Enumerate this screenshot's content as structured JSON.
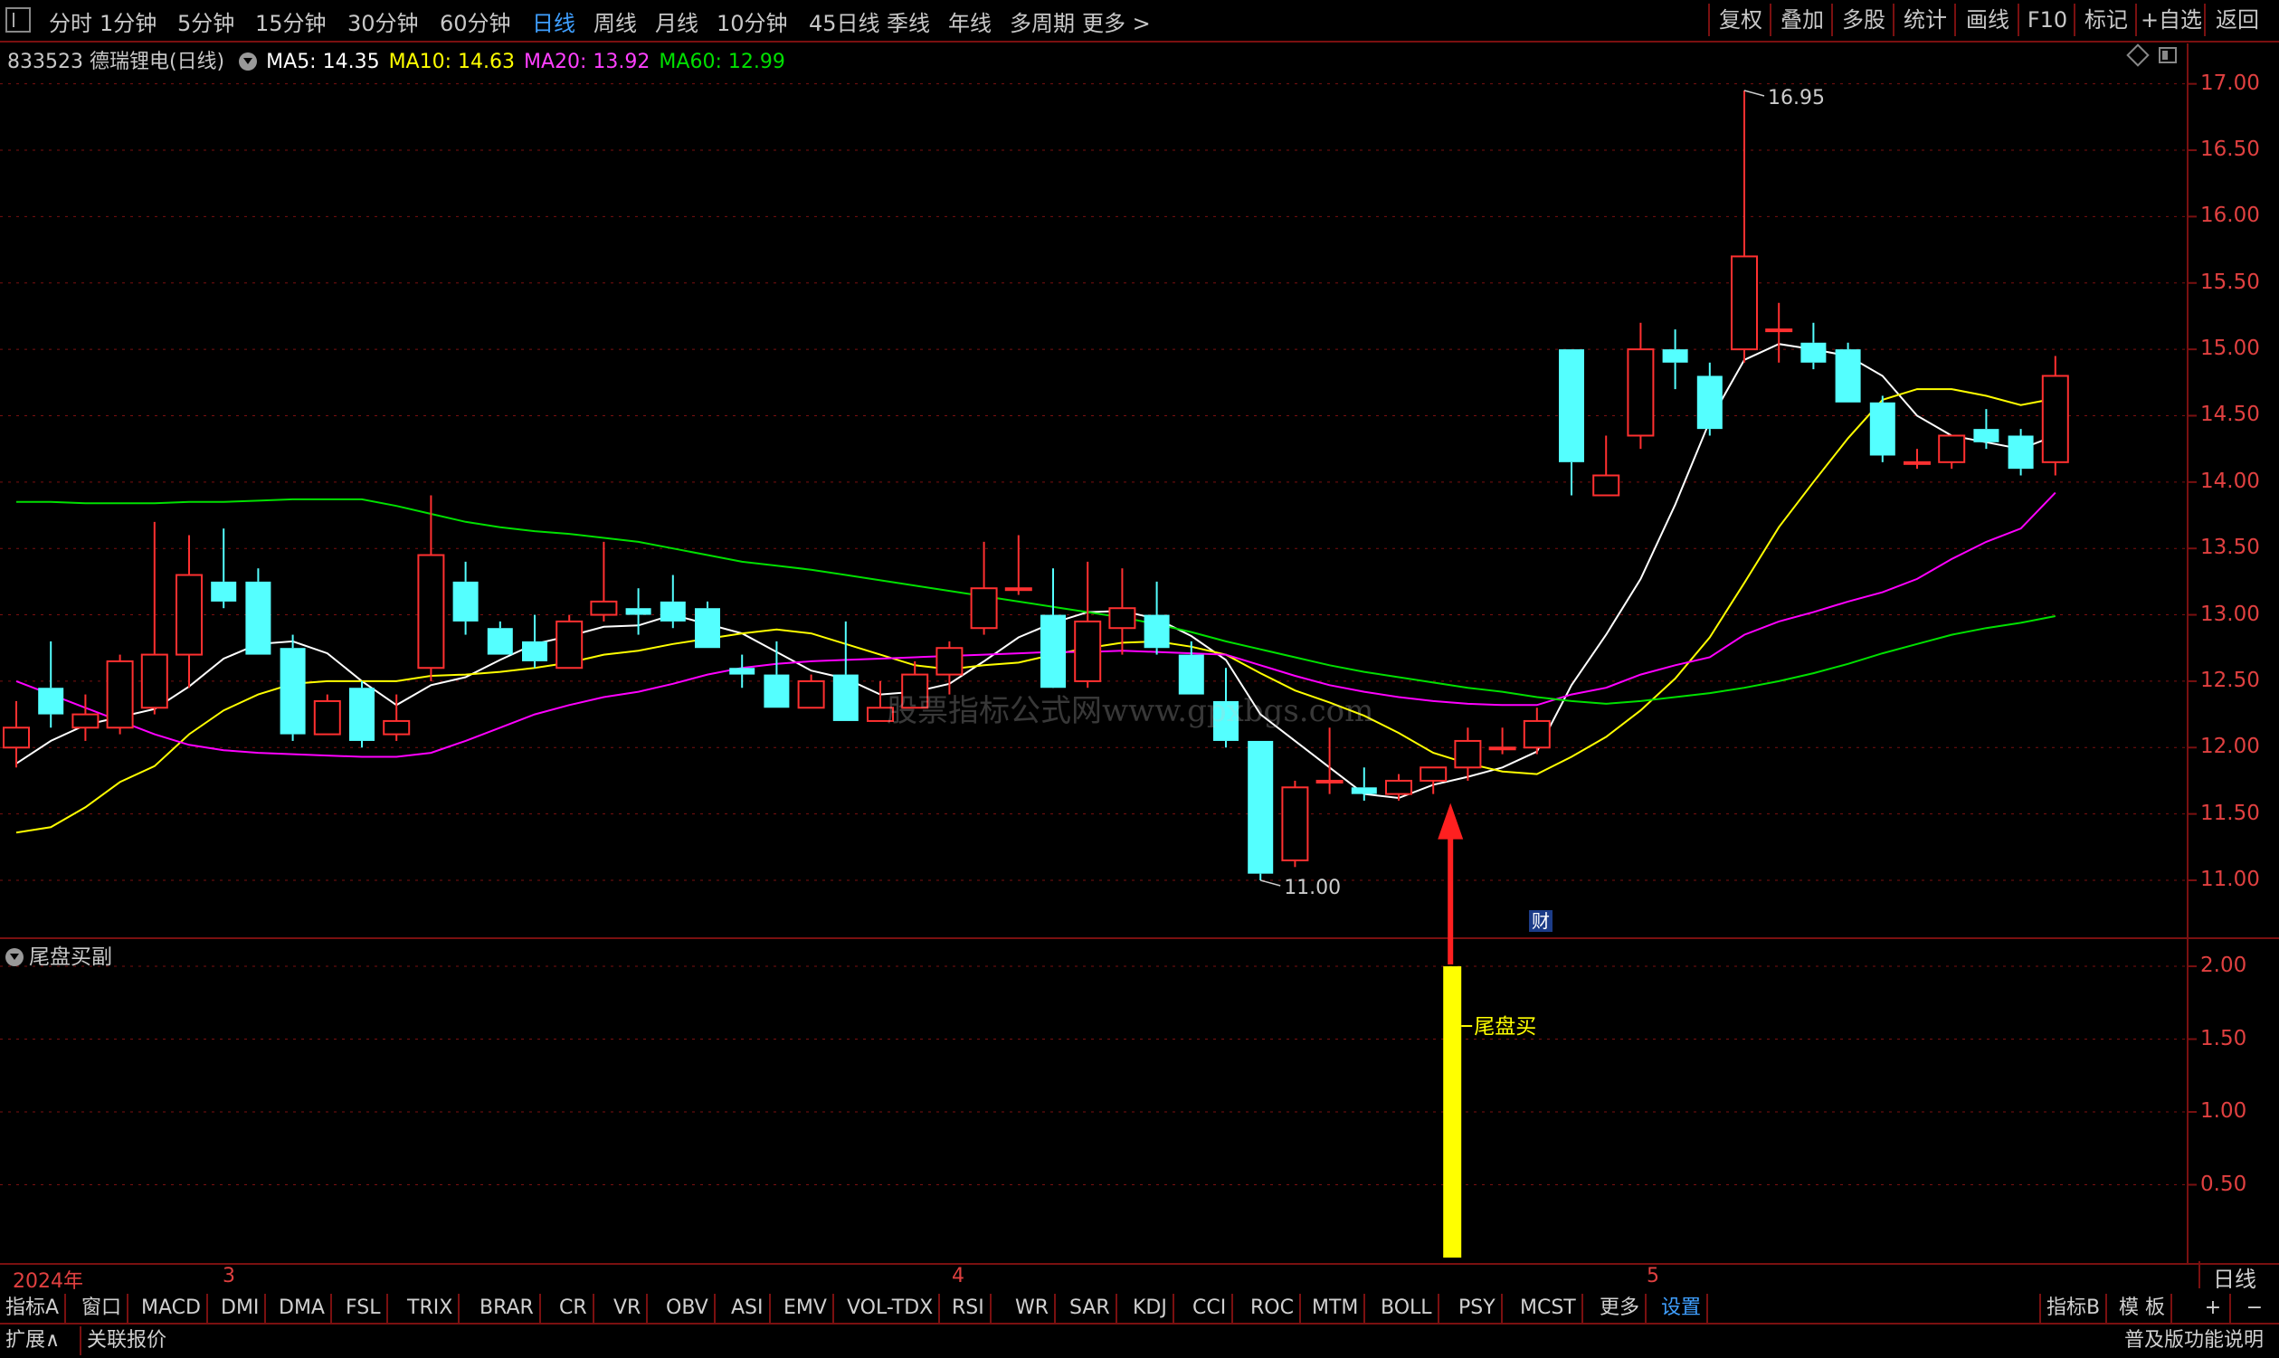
{
  "toolbar": {
    "periods": [
      "分时",
      "1分钟",
      "5分钟",
      "15分钟",
      "30分钟",
      "60分钟",
      "日线",
      "周线",
      "月线",
      "10分钟",
      "45日线",
      "季线",
      "年线",
      "多周期",
      "更多 >"
    ],
    "active_period": "日线",
    "right_buttons": [
      "复权",
      "叠加",
      "多股",
      "统计",
      "画线",
      "F10",
      "标记",
      "+自选",
      "返回"
    ]
  },
  "stock": {
    "code_name": "833523 德瑞锂电(日线)",
    "ma5": "MA5: 14.35",
    "ma10": "MA10: 14.63",
    "ma20": "MA20: 13.92",
    "ma60": "MA60: 12.99"
  },
  "colors": {
    "up": "#ff3030",
    "down": "#54ffff",
    "ma5": "#ffffff",
    "ma10": "#ffff00",
    "ma20": "#ff00ff",
    "ma60": "#00e000",
    "axis": "#e04040",
    "grid": "#7a1010"
  },
  "chart_data": [
    {
      "type": "candlestick",
      "title": "833523 德瑞锂电(日线)",
      "y_ticks": [
        "17.00",
        "16.50",
        "16.00",
        "15.50",
        "15.00",
        "14.50",
        "14.00",
        "13.50",
        "13.00",
        "12.50",
        "12.00",
        "11.50",
        "11.00"
      ],
      "ylim": [
        10.85,
        17.1
      ],
      "annotations": {
        "high_label": "16.95",
        "low_label": "11.00",
        "finance_badge": "财"
      },
      "watermark": "股票指标公式网www.gpxbgs.com",
      "date_labels": [
        "2024年",
        "3",
        "4",
        "5"
      ],
      "candles": [
        {
          "o": 12.0,
          "h": 12.35,
          "l": 11.85,
          "c": 12.15
        },
        {
          "o": 12.45,
          "h": 12.8,
          "l": 12.15,
          "c": 12.25
        },
        {
          "o": 12.15,
          "h": 12.4,
          "l": 12.05,
          "c": 12.25
        },
        {
          "o": 12.15,
          "h": 12.7,
          "l": 12.1,
          "c": 12.65
        },
        {
          "o": 12.3,
          "h": 13.7,
          "l": 12.25,
          "c": 12.7
        },
        {
          "o": 12.7,
          "h": 13.6,
          "l": 12.45,
          "c": 13.3
        },
        {
          "o": 13.25,
          "h": 13.65,
          "l": 13.05,
          "c": 13.1
        },
        {
          "o": 13.25,
          "h": 13.35,
          "l": 12.7,
          "c": 12.7
        },
        {
          "o": 12.75,
          "h": 12.85,
          "l": 12.05,
          "c": 12.1
        },
        {
          "o": 12.1,
          "h": 12.4,
          "l": 12.1,
          "c": 12.35
        },
        {
          "o": 12.45,
          "h": 12.5,
          "l": 12.0,
          "c": 12.05
        },
        {
          "o": 12.1,
          "h": 12.4,
          "l": 12.05,
          "c": 12.2
        },
        {
          "o": 12.6,
          "h": 13.9,
          "l": 12.5,
          "c": 13.45
        },
        {
          "o": 13.25,
          "h": 13.4,
          "l": 12.85,
          "c": 12.95
        },
        {
          "o": 12.9,
          "h": 12.95,
          "l": 12.7,
          "c": 12.7
        },
        {
          "o": 12.8,
          "h": 13.0,
          "l": 12.6,
          "c": 12.65
        },
        {
          "o": 12.6,
          "h": 13.0,
          "l": 12.6,
          "c": 12.95
        },
        {
          "o": 13.0,
          "h": 13.55,
          "l": 12.95,
          "c": 13.1
        },
        {
          "o": 13.05,
          "h": 13.2,
          "l": 12.85,
          "c": 13.0
        },
        {
          "o": 13.1,
          "h": 13.3,
          "l": 12.9,
          "c": 12.95
        },
        {
          "o": 13.05,
          "h": 13.1,
          "l": 12.75,
          "c": 12.75
        },
        {
          "o": 12.6,
          "h": 12.7,
          "l": 12.45,
          "c": 12.55
        },
        {
          "o": 12.55,
          "h": 12.8,
          "l": 12.3,
          "c": 12.3
        },
        {
          "o": 12.3,
          "h": 12.55,
          "l": 12.3,
          "c": 12.5
        },
        {
          "o": 12.55,
          "h": 12.95,
          "l": 12.2,
          "c": 12.2
        },
        {
          "o": 12.2,
          "h": 12.5,
          "l": 12.2,
          "c": 12.3
        },
        {
          "o": 12.3,
          "h": 12.65,
          "l": 12.3,
          "c": 12.55
        },
        {
          "o": 12.55,
          "h": 12.8,
          "l": 12.4,
          "c": 12.75
        },
        {
          "o": 12.9,
          "h": 13.55,
          "l": 12.85,
          "c": 13.2
        },
        {
          "o": 13.2,
          "h": 13.6,
          "l": 13.15,
          "c": 13.2
        },
        {
          "o": 13.0,
          "h": 13.35,
          "l": 12.5,
          "c": 12.45
        },
        {
          "o": 12.5,
          "h": 13.4,
          "l": 12.45,
          "c": 12.95
        },
        {
          "o": 12.9,
          "h": 13.35,
          "l": 12.7,
          "c": 13.05
        },
        {
          "o": 13.0,
          "h": 13.25,
          "l": 12.7,
          "c": 12.75
        },
        {
          "o": 12.7,
          "h": 12.8,
          "l": 12.4,
          "c": 12.4
        },
        {
          "o": 12.35,
          "h": 12.6,
          "l": 12.0,
          "c": 12.05
        },
        {
          "o": 12.05,
          "h": 12.05,
          "l": 11.0,
          "c": 11.05
        },
        {
          "o": 11.15,
          "h": 11.75,
          "l": 11.1,
          "c": 11.7
        },
        {
          "o": 11.75,
          "h": 12.15,
          "l": 11.65,
          "c": 11.75
        },
        {
          "o": 11.7,
          "h": 11.85,
          "l": 11.6,
          "c": 11.65
        },
        {
          "o": 11.65,
          "h": 11.8,
          "l": 11.6,
          "c": 11.75
        },
        {
          "o": 11.75,
          "h": 11.85,
          "l": 11.65,
          "c": 11.85
        },
        {
          "o": 11.85,
          "h": 12.15,
          "l": 11.75,
          "c": 12.05
        },
        {
          "o": 12.0,
          "h": 12.15,
          "l": 11.95,
          "c": 12.0
        },
        {
          "o": 12.0,
          "h": 12.3,
          "l": 11.95,
          "c": 12.2
        },
        {
          "o": 15.0,
          "h": 15.0,
          "l": 13.9,
          "c": 14.15
        },
        {
          "o": 13.9,
          "h": 14.35,
          "l": 13.9,
          "c": 14.05
        },
        {
          "o": 14.35,
          "h": 15.2,
          "l": 14.25,
          "c": 15.0
        },
        {
          "o": 15.0,
          "h": 15.15,
          "l": 14.7,
          "c": 14.9
        },
        {
          "o": 14.8,
          "h": 14.9,
          "l": 14.35,
          "c": 14.4
        },
        {
          "o": 15.0,
          "h": 16.95,
          "l": 14.9,
          "c": 15.7
        },
        {
          "o": 15.15,
          "h": 15.35,
          "l": 14.9,
          "c": 15.15
        },
        {
          "o": 15.05,
          "h": 15.2,
          "l": 14.85,
          "c": 14.9
        },
        {
          "o": 15.0,
          "h": 15.05,
          "l": 14.6,
          "c": 14.6
        },
        {
          "o": 14.6,
          "h": 14.65,
          "l": 14.15,
          "c": 14.2
        },
        {
          "o": 14.15,
          "h": 14.25,
          "l": 14.1,
          "c": 14.15
        },
        {
          "o": 14.15,
          "h": 14.35,
          "l": 14.1,
          "c": 14.35
        },
        {
          "o": 14.4,
          "h": 14.55,
          "l": 14.25,
          "c": 14.3
        },
        {
          "o": 14.35,
          "h": 14.4,
          "l": 14.05,
          "c": 14.1
        },
        {
          "o": 14.15,
          "h": 14.95,
          "l": 14.05,
          "c": 14.8
        }
      ],
      "series": [
        {
          "name": "MA5",
          "values": [
            11.88,
            12.05,
            12.17,
            12.23,
            12.29,
            12.46,
            12.67,
            12.78,
            12.8,
            12.71,
            12.5,
            12.32,
            12.47,
            12.53,
            12.66,
            12.78,
            12.84,
            12.91,
            12.92,
            13.0,
            12.93,
            12.86,
            12.72,
            12.58,
            12.52,
            12.4,
            12.42,
            12.48,
            12.65,
            12.83,
            12.94,
            13.02,
            13.03,
            12.97,
            12.84,
            12.66,
            12.25,
            12.05,
            11.85,
            11.65,
            11.62,
            11.72,
            11.78,
            11.85,
            11.97,
            12.47,
            12.85,
            13.27,
            13.83,
            14.46,
            14.92,
            15.04,
            15.0,
            14.95,
            14.8,
            14.5,
            14.35,
            14.3,
            14.25,
            14.35
          ]
        },
        {
          "name": "MA10",
          "values": [
            11.36,
            11.4,
            11.55,
            11.74,
            11.86,
            12.1,
            12.28,
            12.4,
            12.48,
            12.5,
            12.5,
            12.5,
            12.54,
            12.55,
            12.57,
            12.6,
            12.64,
            12.7,
            12.73,
            12.78,
            12.82,
            12.86,
            12.89,
            12.86,
            12.78,
            12.7,
            12.62,
            12.59,
            12.62,
            12.64,
            12.7,
            12.75,
            12.79,
            12.8,
            12.76,
            12.7,
            12.56,
            12.43,
            12.34,
            12.24,
            12.11,
            11.96,
            11.88,
            11.82,
            11.8,
            11.93,
            12.08,
            12.28,
            12.52,
            12.83,
            13.24,
            13.66,
            14.0,
            14.33,
            14.62,
            14.7,
            14.7,
            14.65,
            14.58,
            14.63
          ]
        },
        {
          "name": "MA20",
          "values": [
            12.5,
            12.4,
            12.3,
            12.2,
            12.1,
            12.02,
            11.98,
            11.96,
            11.95,
            11.94,
            11.93,
            11.93,
            11.96,
            12.05,
            12.15,
            12.25,
            12.32,
            12.38,
            12.42,
            12.48,
            12.55,
            12.6,
            12.63,
            12.65,
            12.66,
            12.67,
            12.68,
            12.69,
            12.7,
            12.71,
            12.72,
            12.72,
            12.73,
            12.72,
            12.71,
            12.7,
            12.62,
            12.54,
            12.47,
            12.42,
            12.38,
            12.35,
            12.33,
            12.32,
            12.32,
            12.4,
            12.45,
            12.55,
            12.62,
            12.68,
            12.85,
            12.95,
            13.02,
            13.1,
            13.17,
            13.27,
            13.42,
            13.55,
            13.65,
            13.92
          ]
        },
        {
          "name": "MA60",
          "values": [
            13.85,
            13.85,
            13.84,
            13.84,
            13.84,
            13.85,
            13.85,
            13.86,
            13.87,
            13.87,
            13.87,
            13.82,
            13.76,
            13.7,
            13.66,
            13.63,
            13.61,
            13.58,
            13.55,
            13.5,
            13.45,
            13.4,
            13.37,
            13.34,
            13.3,
            13.26,
            13.22,
            13.18,
            13.14,
            13.1,
            13.06,
            13.02,
            12.98,
            12.93,
            12.87,
            12.8,
            12.74,
            12.68,
            12.62,
            12.57,
            12.53,
            12.49,
            12.45,
            12.42,
            12.38,
            12.35,
            12.33,
            12.35,
            12.38,
            12.41,
            12.45,
            12.5,
            12.56,
            12.63,
            12.71,
            12.78,
            12.85,
            12.9,
            12.94,
            12.99
          ]
        }
      ]
    },
    {
      "type": "bar",
      "title": "尾盘买副",
      "y_ticks": [
        "2.00",
        "1.50",
        "1.00",
        "0.50"
      ],
      "ylim": [
        0,
        2.05
      ],
      "signal_index": 41,
      "signal_value": 2,
      "signal_label": "尾盘买",
      "signal_color": "#ffff00"
    }
  ],
  "indicators": [
    "指标A",
    "窗口",
    "MACD",
    "DMI",
    "DMA",
    "FSL",
    "TRIX",
    "BRAR",
    "CR",
    "VR",
    "OBV",
    "ASI",
    "EMV",
    "VOL-TDX",
    "RSI",
    "WR",
    "SAR",
    "KDJ",
    "CCI",
    "ROC",
    "MTM",
    "BOLL",
    "PSY",
    "MCST",
    "更多",
    "设置"
  ],
  "active_indicator": "设置",
  "indicator_b": "指标B",
  "template_btn": "模 板",
  "plus_btn": "+",
  "minus_btn": "−",
  "date_axis_mode": "日线",
  "status": {
    "expand": "扩展∧",
    "related": "关联报价",
    "notice": "普及版功能说明"
  }
}
